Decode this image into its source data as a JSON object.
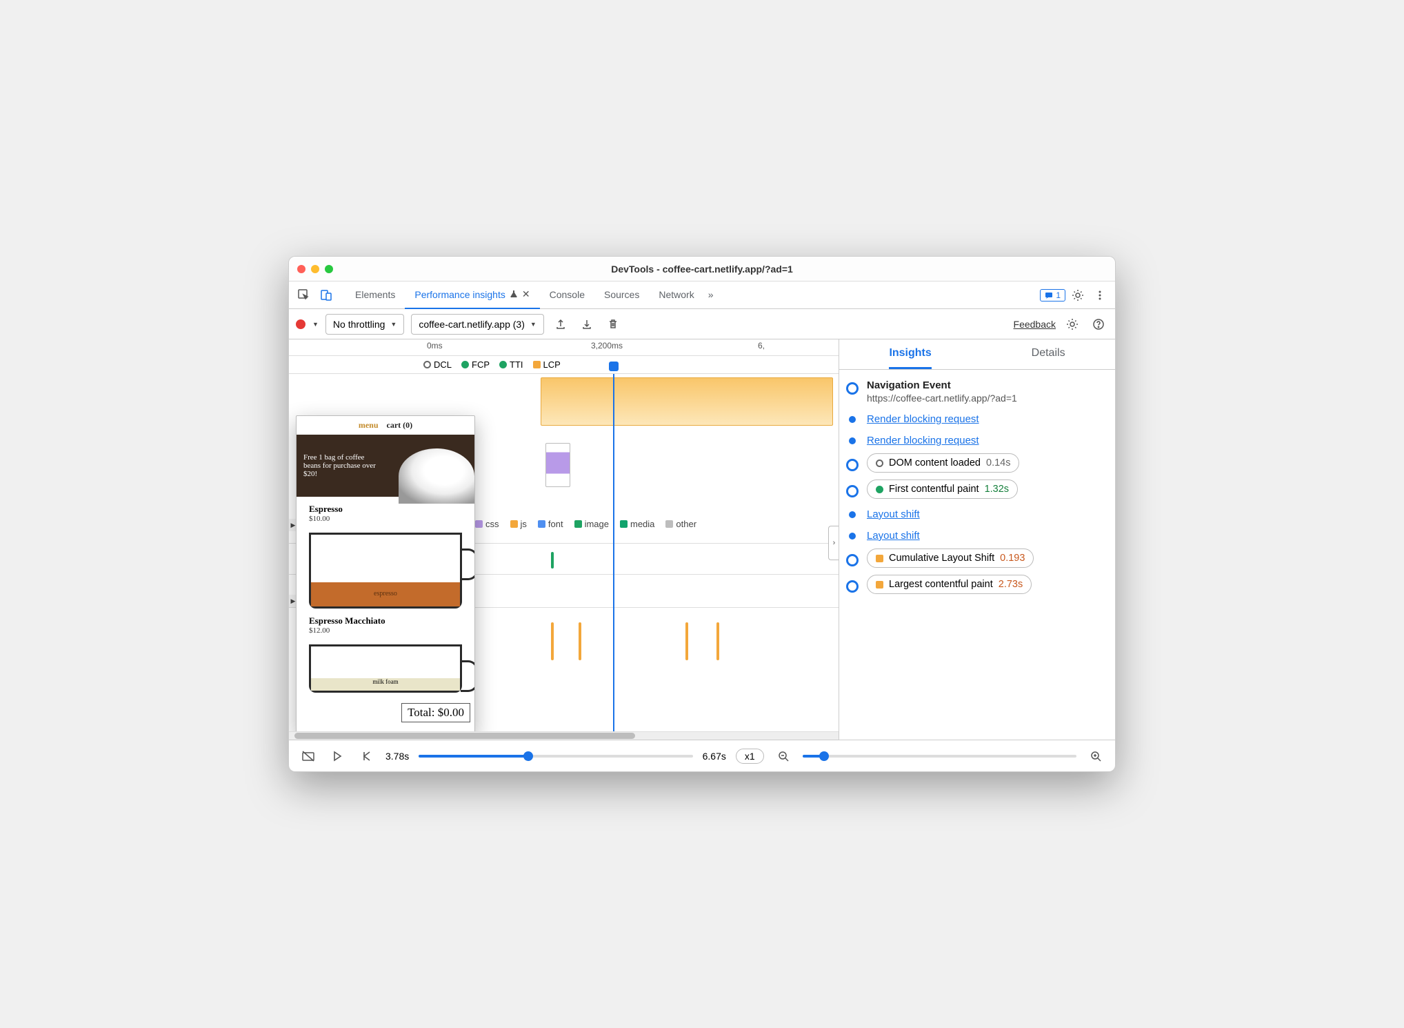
{
  "window_title": "DevTools - coffee-cart.netlify.app/?ad=1",
  "tabs": {
    "elements": "Elements",
    "perf": "Performance insights",
    "console": "Console",
    "sources": "Sources",
    "network": "Network"
  },
  "issues_badge": "1",
  "toolbar": {
    "throttling": "No throttling",
    "profile": "coffee-cart.netlify.app (3)",
    "feedback": "Feedback"
  },
  "timeline": {
    "tick0": "0ms",
    "tick1": "3,200ms",
    "tick2": "6,",
    "markers": {
      "dcl": "DCL",
      "fcp": "FCP",
      "tti": "TTI",
      "lcp": "LCP"
    },
    "legend": {
      "css": "css",
      "js": "js",
      "font": "font",
      "image": "image",
      "media": "media",
      "other": "other"
    }
  },
  "preview": {
    "menu": "menu",
    "cart": "cart (0)",
    "hero": "Free 1 bag of coffee beans for purchase over $20!",
    "p1_name": "Espresso",
    "p1_price": "$10.00",
    "p1_fill": "espresso",
    "p2_name": "Espresso Macchiato",
    "p2_price": "$12.00",
    "p2_foam": "milk foam",
    "total": "Total: $0.00"
  },
  "sidebar": {
    "tab_insights": "Insights",
    "tab_details": "Details",
    "nav_event": "Navigation Event",
    "nav_url": "https://coffee-cart.netlify.app/?ad=1",
    "rbr": "Render blocking request",
    "dcl_label": "DOM content loaded",
    "dcl_val": "0.14s",
    "fcp_label": "First contentful paint",
    "fcp_val": "1.32s",
    "layout_shift": "Layout shift",
    "cls_label": "Cumulative Layout Shift",
    "cls_val": "0.193",
    "lcp_label": "Largest contentful paint",
    "lcp_val": "2.73s"
  },
  "footer": {
    "current": "3.78s",
    "total": "6.67s",
    "zoom": "x1"
  },
  "colors": {
    "fcp": "#1ea362",
    "tti": "#1ea362",
    "lcp": "#f3a73b",
    "css": "#b89ae8",
    "js": "#f3a73b",
    "font": "#4f8ff0",
    "image": "#1ea362",
    "media": "#11a36c",
    "other": "#bdbdbd"
  }
}
